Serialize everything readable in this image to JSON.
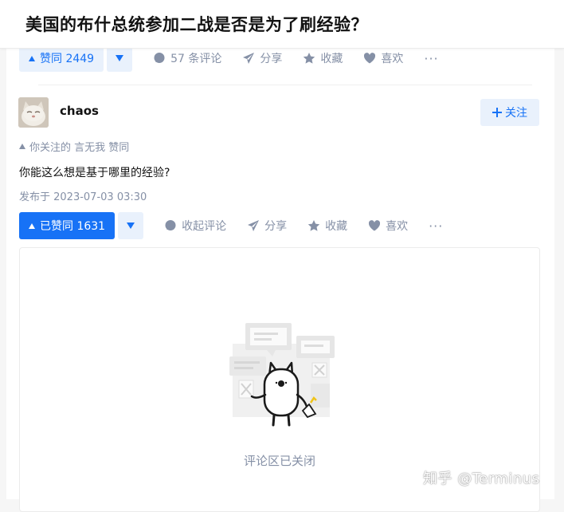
{
  "question": {
    "title": "美国的布什总统参加二战是否是为了刷经验？"
  },
  "top_answer_actions": {
    "upvote_label": "赞同 2449",
    "comments_label": "57 条评论",
    "share_label": "分享",
    "collect_label": "收藏",
    "like_label": "喜欢",
    "more_label": "···"
  },
  "answer": {
    "author_name": "chaos",
    "avatar_icon": "cat-avatar",
    "follow_label": "关注",
    "voter_text": "你关注的 言无我 赞同",
    "content": "你能这么想是基于哪里的经验?",
    "published": "发布于 2023-07-03 03:30",
    "actions": {
      "upvote_label": "已赞同 1631",
      "comments_label": "收起评论",
      "share_label": "分享",
      "collect_label": "收藏",
      "like_label": "喜欢",
      "more_label": "···"
    },
    "comments_closed_text": "评论区已关闭"
  },
  "watermark": "知乎 @Terminus",
  "colors": {
    "accent": "#1772f6",
    "accent_light_bg": "#e9f1fc",
    "muted_text": "#8590a6",
    "page_bg": "#f6f6f6"
  }
}
